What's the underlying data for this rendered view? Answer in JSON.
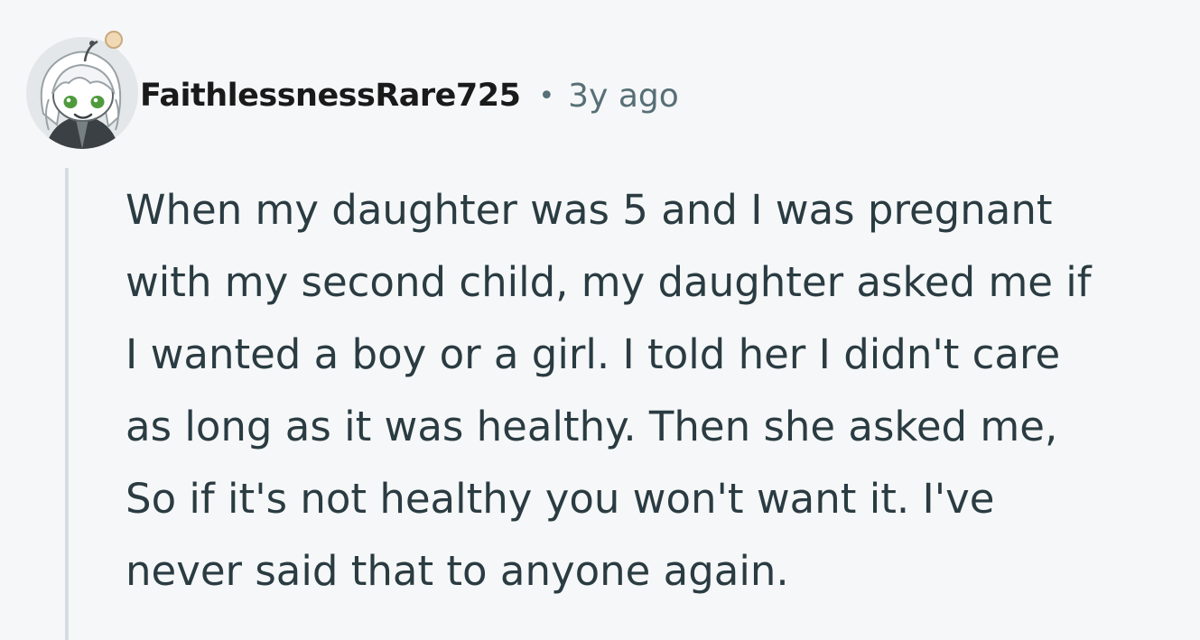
{
  "comment": {
    "author": "FaithlessnessRare725",
    "separator": "•",
    "timestamp": "3y ago",
    "avatar_icon": "snoo-avatar-icon",
    "body_lines": [
      "When my daughter was 5 and I was pregnant",
      "with my second child, my daughter asked me if",
      "I wanted a boy or a girl. I told her I didn't care",
      "as long as it was healthy. Then she asked me,",
      "So if it's not healthy you won't want it. I've",
      "never said that to anyone again."
    ]
  },
  "colors": {
    "background": "#f6f7f8",
    "author": "#1a1a1b",
    "meta": "#576f76",
    "body_text": "#2a3c42",
    "thread_line": "#d4dde3"
  }
}
